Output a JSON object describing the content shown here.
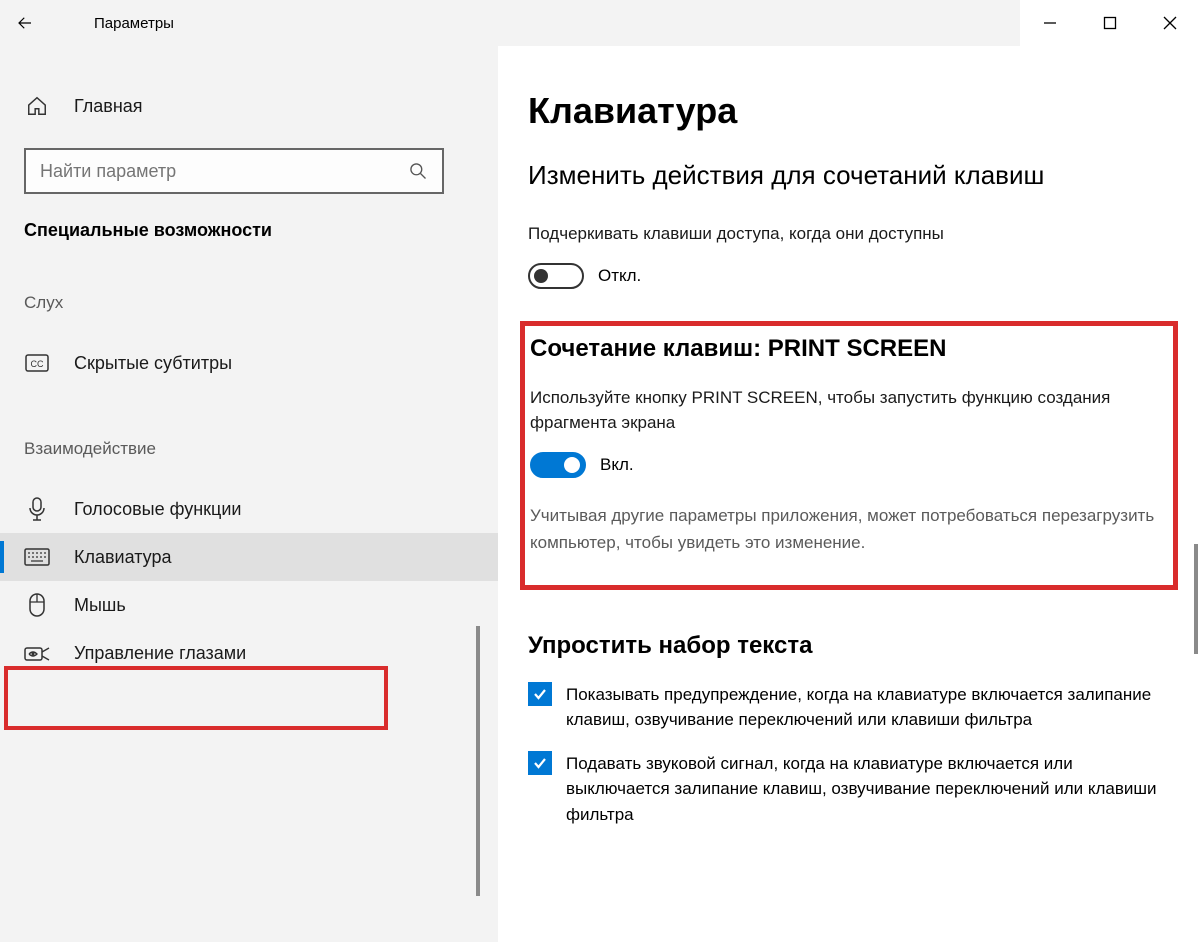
{
  "window": {
    "title": "Параметры"
  },
  "sidebar": {
    "home": "Главная",
    "search_placeholder": "Найти параметр",
    "category": "Специальные возможности",
    "group_hearing": "Слух",
    "item_captions": "Скрытые субтитры",
    "group_interaction": "Взаимодействие",
    "item_speech": "Голосовые функции",
    "item_keyboard": "Клавиатура",
    "item_mouse": "Мышь",
    "item_eye": "Управление глазами"
  },
  "main": {
    "title": "Клавиатура",
    "shortcut_header": "Изменить действия для сочетаний клавиш",
    "underline_desc": "Подчеркивать клавиши доступа, когда они доступны",
    "underline_state": "Откл.",
    "ps_header": "Сочетание клавиш: PRINT SCREEN",
    "ps_desc": "Используйте кнопку PRINT SCREEN, чтобы запустить функцию создания фрагмента экрана",
    "ps_state": "Вкл.",
    "ps_note": "Учитывая другие параметры приложения, может потребоваться перезагрузить компьютер, чтобы увидеть это изменение.",
    "simplify_header": "Упростить набор текста",
    "chk1": "Показывать предупреждение, когда на клавиатуре включается залипание клавиш, озвучивание переключений или клавиши фильтра",
    "chk2": "Подавать звуковой сигнал, когда на клавиатуре включается или выключается залипание клавиш, озвучивание переключений или клавиши фильтра"
  }
}
